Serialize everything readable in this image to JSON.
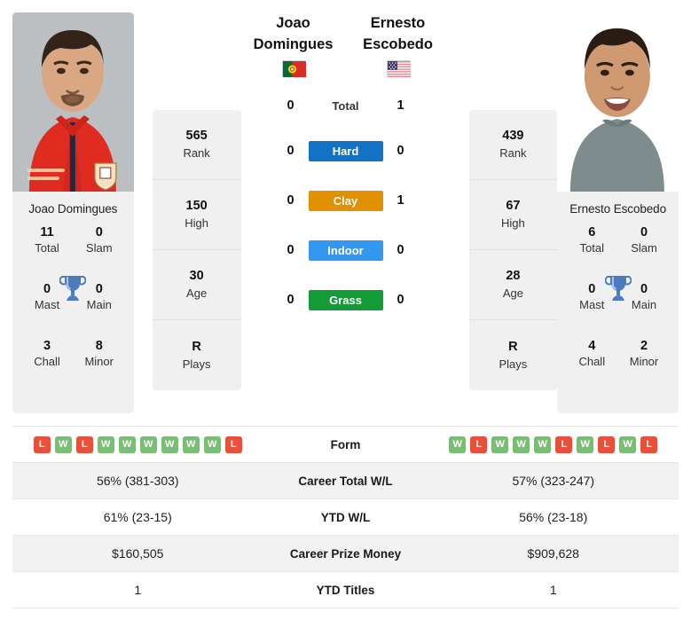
{
  "players": {
    "left": {
      "first_name": "Joao",
      "last_name": "Domingues",
      "full_name": "Joao Domingues",
      "country": "Portugal",
      "flag_icon": "portugal-flag-icon",
      "rank": "565",
      "rank_label": "Rank",
      "high": "150",
      "high_label": "High",
      "age": "30",
      "age_label": "Age",
      "plays": "R",
      "plays_label": "Plays",
      "titles": {
        "total": "11",
        "total_label": "Total",
        "slam": "0",
        "slam_label": "Slam",
        "mast": "0",
        "mast_label": "Mast",
        "main": "0",
        "main_label": "Main",
        "chall": "3",
        "chall_label": "Chall",
        "minor": "8",
        "minor_label": "Minor"
      },
      "form": [
        "L",
        "W",
        "L",
        "W",
        "W",
        "W",
        "W",
        "W",
        "W",
        "L"
      ],
      "career_wl": "56% (381-303)",
      "ytd_wl": "61% (23-15)",
      "career_prize_money": "$160,505",
      "ytd_titles": "1"
    },
    "right": {
      "first_name": "Ernesto",
      "last_name": "Escobedo",
      "full_name": "Ernesto Escobedo",
      "country": "United States",
      "flag_icon": "usa-flag-icon",
      "rank": "439",
      "rank_label": "Rank",
      "high": "67",
      "high_label": "High",
      "age": "28",
      "age_label": "Age",
      "plays": "R",
      "plays_label": "Plays",
      "titles": {
        "total": "6",
        "total_label": "Total",
        "slam": "0",
        "slam_label": "Slam",
        "mast": "0",
        "mast_label": "Mast",
        "main": "0",
        "main_label": "Main",
        "chall": "4",
        "chall_label": "Chall",
        "minor": "2",
        "minor_label": "Minor"
      },
      "form": [
        "W",
        "L",
        "W",
        "W",
        "W",
        "L",
        "W",
        "L",
        "W",
        "L"
      ],
      "career_wl": "57% (323-247)",
      "ytd_wl": "56% (23-18)",
      "career_prize_money": "$909,628",
      "ytd_titles": "1"
    }
  },
  "head_to_head": [
    {
      "label": "Total",
      "left": "0",
      "right": "1",
      "type": "plain",
      "color": ""
    },
    {
      "label": "Hard",
      "left": "0",
      "right": "0",
      "type": "badge",
      "color": "#1272c4"
    },
    {
      "label": "Clay",
      "left": "0",
      "right": "1",
      "type": "badge",
      "color": "#e09000"
    },
    {
      "label": "Indoor",
      "left": "0",
      "right": "0",
      "type": "badge",
      "color": "#3498f0"
    },
    {
      "label": "Grass",
      "left": "0",
      "right": "0",
      "type": "badge",
      "color": "#139b38"
    }
  ],
  "stats_rows": [
    {
      "label": "Form",
      "key": "form",
      "type": "form"
    },
    {
      "label": "Career Total W/L",
      "key": "career_wl",
      "type": "text"
    },
    {
      "label": "YTD W/L",
      "key": "ytd_wl",
      "type": "text"
    },
    {
      "label": "Career Prize Money",
      "key": "career_prize_money",
      "type": "text"
    },
    {
      "label": "YTD Titles",
      "key": "ytd_titles",
      "type": "text"
    }
  ],
  "colors": {
    "win_badge": "#79bd76",
    "loss_badge": "#e8503a",
    "card_background": "#f0f0f0",
    "row_shaded": "#f2f2f2"
  },
  "icons": {
    "trophy": "trophy-icon"
  }
}
